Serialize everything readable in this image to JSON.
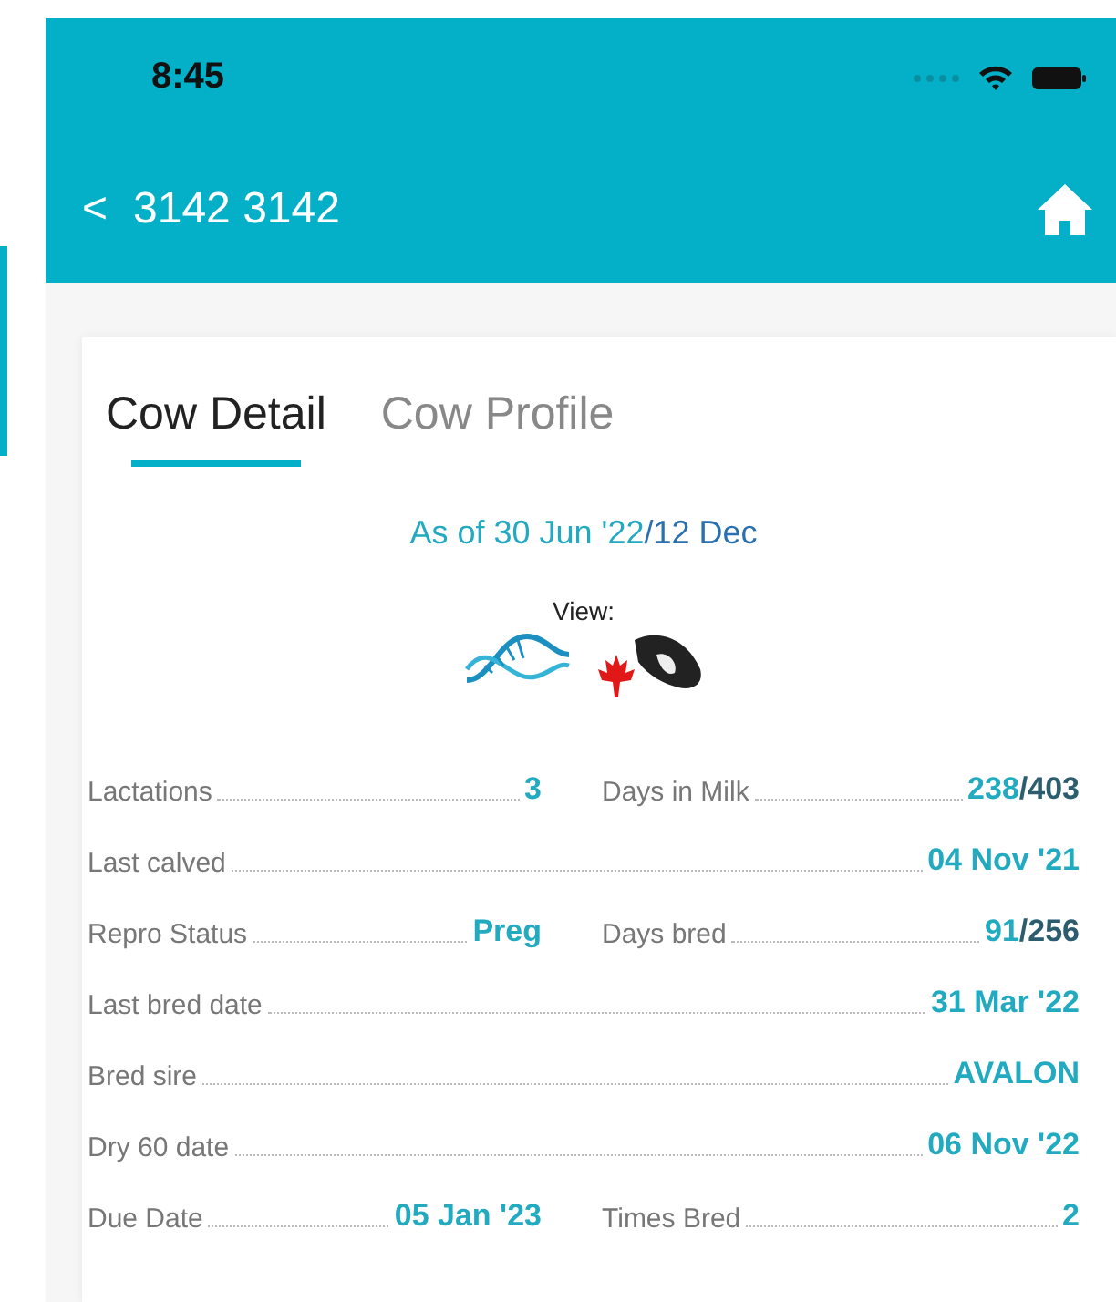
{
  "status_bar": {
    "time": "8:45"
  },
  "nav": {
    "back": "<",
    "title": "3142 3142"
  },
  "tabs": [
    {
      "label": "Cow Detail",
      "selected": true
    },
    {
      "label": "Cow Profile",
      "selected": false
    }
  ],
  "as_of": {
    "date": "As of 30 Jun '22",
    "extra": "/12 Dec"
  },
  "view": {
    "label": "View:"
  },
  "rows": [
    {
      "kind": "pair",
      "items": [
        {
          "label": "Lactations",
          "value": "3"
        },
        {
          "label": "Days in Milk",
          "value": "238",
          "suffix": "/403"
        }
      ]
    },
    {
      "kind": "full",
      "items": [
        {
          "label": "Last calved",
          "value": "04 Nov '21"
        }
      ]
    },
    {
      "kind": "pair",
      "items": [
        {
          "label": "Repro Status",
          "value": "Preg"
        },
        {
          "label": "Days bred",
          "value": "91",
          "suffix": "/256"
        }
      ]
    },
    {
      "kind": "full",
      "items": [
        {
          "label": "Last bred date",
          "value": "31 Mar '22"
        }
      ]
    },
    {
      "kind": "full",
      "items": [
        {
          "label": "Bred sire",
          "value": "AVALON"
        }
      ]
    },
    {
      "kind": "full",
      "items": [
        {
          "label": "Dry 60 date",
          "value": "06 Nov '22"
        }
      ]
    },
    {
      "kind": "pair",
      "items": [
        {
          "label": "Due Date",
          "value": "05 Jan '23"
        },
        {
          "label": "Times Bred",
          "value": "2"
        }
      ]
    }
  ]
}
